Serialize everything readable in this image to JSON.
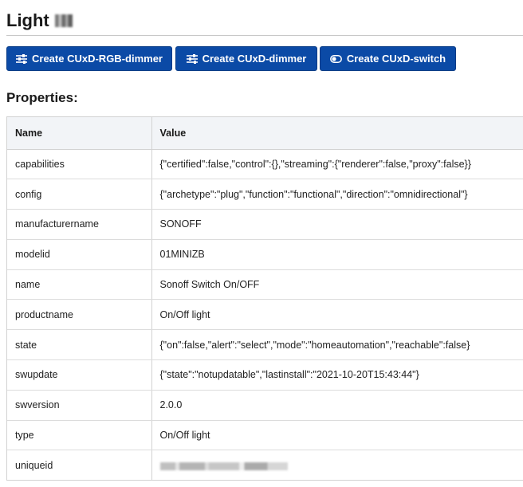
{
  "page": {
    "title": "Light"
  },
  "toolbar": {
    "buttons": [
      {
        "label": "Create CUxD-RGB-dimmer",
        "icon": "sliders-icon"
      },
      {
        "label": "Create CUxD-dimmer",
        "icon": "sliders-icon"
      },
      {
        "label": "Create CUxD-switch",
        "icon": "toggle-icon"
      }
    ]
  },
  "properties": {
    "heading": "Properties:",
    "columns": [
      "Name",
      "Value"
    ],
    "rows": [
      {
        "name": "capabilities",
        "value": "{\"certified\":false,\"control\":{},\"streaming\":{\"renderer\":false,\"proxy\":false}}"
      },
      {
        "name": "config",
        "value": "{\"archetype\":\"plug\",\"function\":\"functional\",\"direction\":\"omnidirectional\"}"
      },
      {
        "name": "manufacturername",
        "value": "SONOFF"
      },
      {
        "name": "modelid",
        "value": "01MINIZB"
      },
      {
        "name": "name",
        "value": "Sonoff Switch On/OFF"
      },
      {
        "name": "productname",
        "value": "On/Off light"
      },
      {
        "name": "state",
        "value": "{\"on\":false,\"alert\":\"select\",\"mode\":\"homeautomation\",\"reachable\":false}"
      },
      {
        "name": "swupdate",
        "value": "{\"state\":\"notupdatable\",\"lastinstall\":\"2021-10-20T15:43:44\"}"
      },
      {
        "name": "swversion",
        "value": "2.0.0"
      },
      {
        "name": "type",
        "value": "On/Off light"
      },
      {
        "name": "uniqueid",
        "value": ""
      }
    ]
  },
  "colors": {
    "button_bg": "#0b4aa6",
    "button_text": "#ffffff",
    "header_bg": "#f2f4f7",
    "border": "#d2d2d2"
  }
}
